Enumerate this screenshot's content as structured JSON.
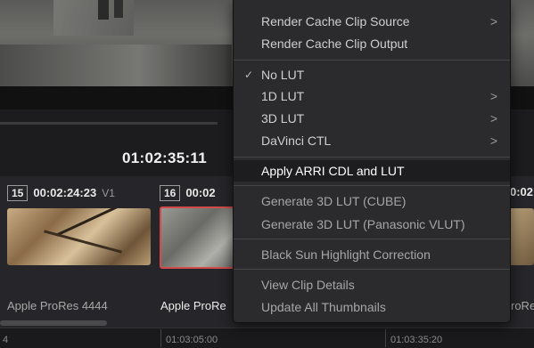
{
  "viewer": {
    "timecode": "01:02:35:11"
  },
  "clips": [
    {
      "number": "15",
      "timecode": "00:02:24:23",
      "track": "V1",
      "codec": "Apple ProRes 4444"
    },
    {
      "number": "16",
      "timecode": "00:02",
      "codec": "Apple ProRe"
    },
    {
      "timecode": "0:02",
      "codec": "roRe"
    }
  ],
  "ruler": {
    "ticks": [
      "4",
      "01:03:05:00",
      "01:03:35:20"
    ]
  },
  "context_menu": {
    "items": [
      {
        "label": "Render Cache Clip Source",
        "submenu": true
      },
      {
        "label": "Render Cache Clip Output",
        "submenu": false
      },
      {
        "label": "No LUT",
        "checked": true,
        "submenu": false
      },
      {
        "label": "1D LUT",
        "submenu": true
      },
      {
        "label": "3D LUT",
        "submenu": true
      },
      {
        "label": "DaVinci CTL",
        "submenu": true
      },
      {
        "label": "Apply ARRI CDL and LUT",
        "submenu": false,
        "highlighted": true
      },
      {
        "label": "Generate 3D LUT (CUBE)",
        "submenu": false
      },
      {
        "label": "Generate 3D LUT (Panasonic VLUT)",
        "submenu": false
      },
      {
        "label": "Black Sun Highlight Correction",
        "submenu": false
      },
      {
        "label": "View Clip Details",
        "submenu": false
      },
      {
        "label": "Update All Thumbnails",
        "submenu": false
      }
    ],
    "check_glyph": "✓",
    "arrow_glyph": ">"
  },
  "colors": {
    "selected_clip_border": "#d24a4a",
    "menu_background": "#2b2b2d",
    "menu_highlight": "#1d1d1f"
  }
}
